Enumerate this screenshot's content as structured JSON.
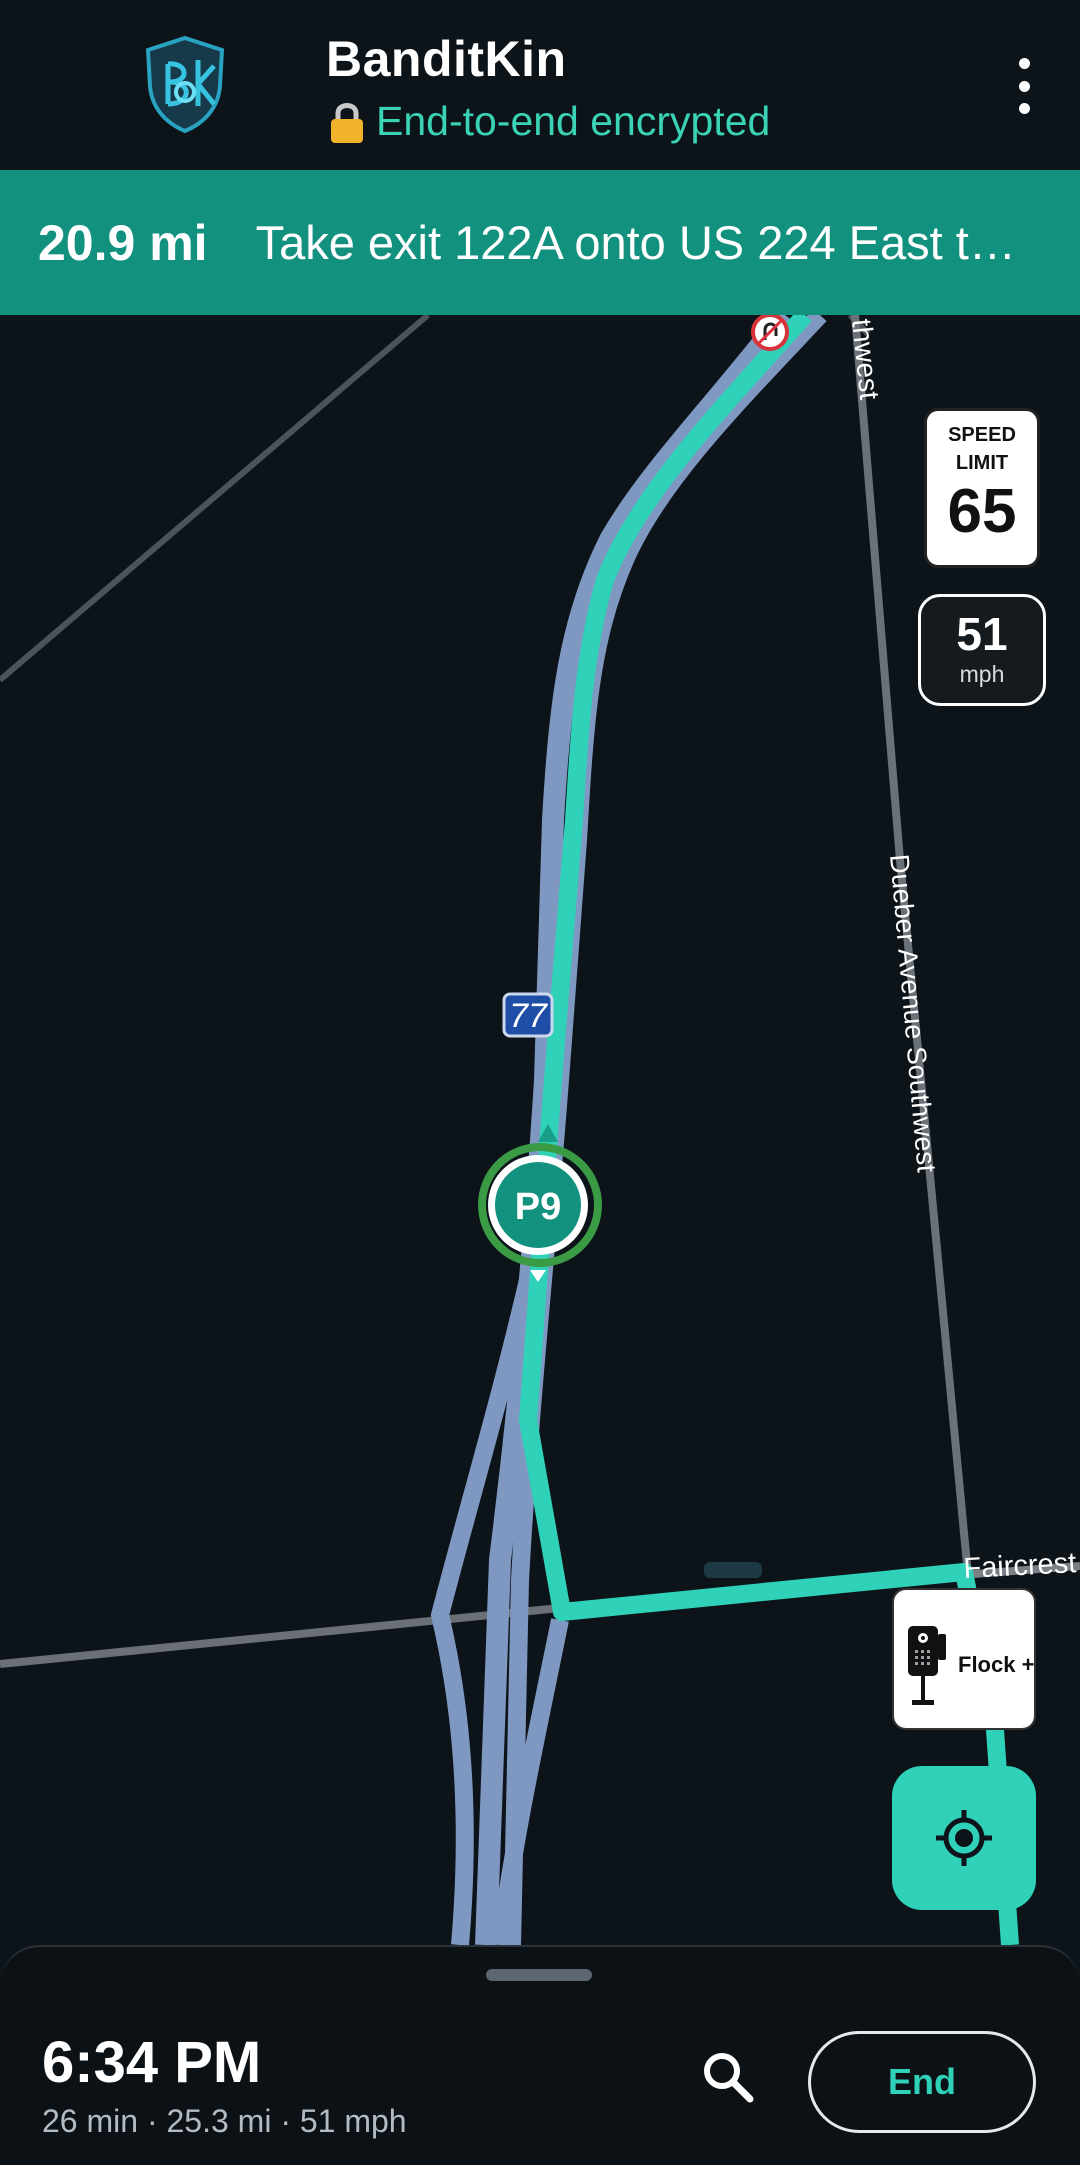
{
  "app": {
    "title": "BanditKin",
    "encryption_status": "End-to-end encrypted",
    "logo_icon": "shield-lock-logo-icon",
    "menu_icon": "more-vertical-icon"
  },
  "navigation": {
    "distance": "20.9 mi",
    "instruction": "Take exit 122A onto US 224 East to…"
  },
  "map": {
    "roads": {
      "upper_road": "thwest",
      "side_road": "Dueber Avenue Southwest",
      "cross_road": "Faircrest",
      "highway_shield": "77"
    },
    "position_marker": "P9",
    "no_u_turn_icon": "no-u-turn-icon"
  },
  "speed": {
    "limit_caption": "SPEED LIMIT",
    "limit_caption_line1": "SPEED",
    "limit_caption_line2": "LIMIT",
    "limit_value": "65",
    "current_value": "51",
    "current_unit": "mph"
  },
  "alert": {
    "label": "Flock +",
    "icon": "flock-camera-icon"
  },
  "controls": {
    "recenter_icon": "gps-recenter-icon",
    "search_icon": "search-icon"
  },
  "trip": {
    "eta": "6:34 PM",
    "summary": "26 min · 25.3 mi · 51 mph",
    "end_label": "End"
  },
  "colors": {
    "accent": "#2fd2b8",
    "banner": "#13917f",
    "background": "#0c1319",
    "highway": "#7f98c2"
  }
}
